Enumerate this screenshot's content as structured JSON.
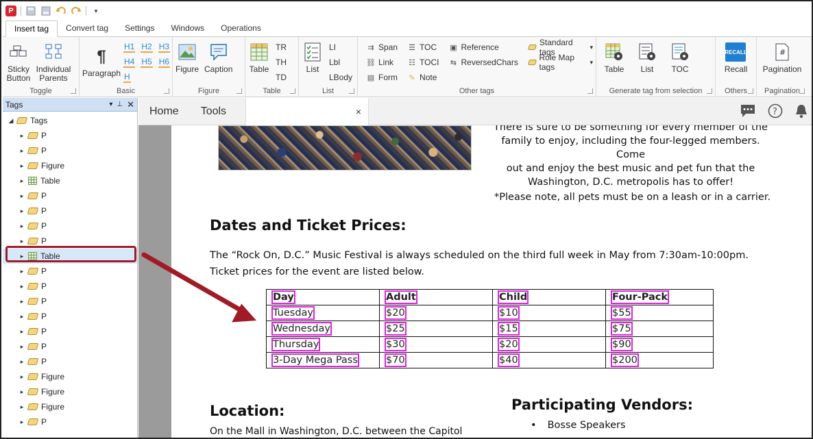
{
  "app": {
    "logo_letter": "P"
  },
  "ribbon_tabs": [
    "Insert tag",
    "Convert tag",
    "Settings",
    "Windows",
    "Operations"
  ],
  "ribbon": {
    "toggle": {
      "sticky": "Sticky\nButton",
      "individual": "Individual\nParents",
      "label": "Toggle"
    },
    "basic": {
      "paragraph": "Paragraph",
      "h1": "H1",
      "h2": "H2",
      "h3": "H3",
      "h4": "H4",
      "h5": "H5",
      "h6": "H6",
      "h": "H",
      "label": "Basic"
    },
    "figure": {
      "figure": "Figure",
      "caption": "Caption",
      "label": "Figure"
    },
    "table": {
      "table": "Table",
      "tr": "TR",
      "th": "TH",
      "td": "TD",
      "label": "Table"
    },
    "list": {
      "list": "List",
      "li": "LI",
      "lbl": "Lbl",
      "lbody": "LBody",
      "label": "List"
    },
    "other": {
      "span": "Span",
      "link": "Link",
      "form": "Form",
      "toc": "TOC",
      "toci": "TOCI",
      "note": "Note",
      "reference": "Reference",
      "reversed": "ReversedChars",
      "standard": "Standard tags",
      "rolemap": "Role Map tags",
      "label": "Other tags"
    },
    "generate": {
      "table": "Table",
      "list": "List",
      "toc": "TOC",
      "label": "Generate tag from selection"
    },
    "others": {
      "recall": "Recall",
      "recall_icon_text": "RECALL",
      "label": "Others"
    },
    "pagination": {
      "pagination": "Pagination",
      "label": "Pagination"
    }
  },
  "tags_panel": {
    "title": "Tags",
    "root": "Tags",
    "items": [
      "P",
      "P",
      "Figure",
      "Table",
      "P",
      "P",
      "P",
      "P",
      "Table",
      "P",
      "P",
      "P",
      "P",
      "P",
      "P",
      "P",
      "Figure",
      "Figure",
      "Figure",
      "P"
    ]
  },
  "doc_tabs": {
    "home": "Home",
    "tools": "Tools",
    "close": "×"
  },
  "document": {
    "intro_lines": [
      "There is sure to be something for every member of the",
      "family to enjoy, including the four-legged members.  Come",
      "out and enjoy the best music and pet fun that the",
      "Washington, D.C. metropolis has to offer!"
    ],
    "note": "*Please note, all pets must be on a leash or in a carrier.",
    "heading_dates": "Dates and Ticket Prices:",
    "dates_p1": "The “Rock On, D.C.” Music Festival is always scheduled on the third full week in May from 7:30am-10:00pm.",
    "dates_p2": "Ticket prices for the event are listed below.",
    "table": {
      "headers": [
        "Day",
        "Adult",
        "Child",
        "Four-Pack"
      ],
      "rows": [
        [
          "Tuesday",
          "$20",
          "$10",
          "$55"
        ],
        [
          "Wednesday",
          "$25",
          "$15",
          "$75"
        ],
        [
          "Thursday",
          "$30",
          "$20",
          "$90"
        ],
        [
          "3-Day Mega Pass",
          "$70",
          "$40",
          "$200"
        ]
      ]
    },
    "heading_location": "Location:",
    "location_text": "On the Mall in Washington, D.C. between the Capitol",
    "heading_vendors": "Participating Vendors:",
    "vendor_1": "Bosse Speakers"
  }
}
